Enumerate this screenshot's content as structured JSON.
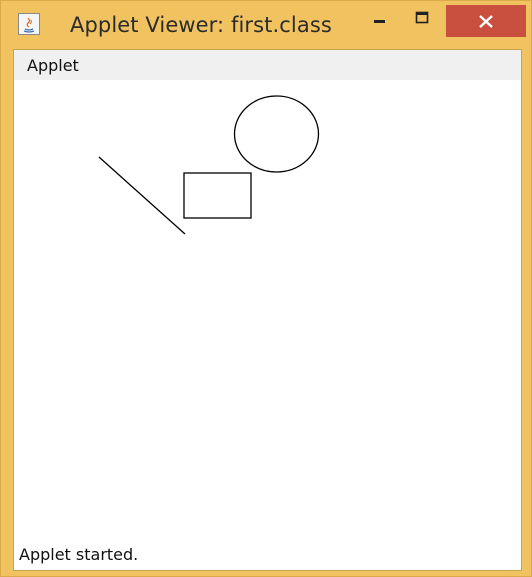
{
  "window": {
    "title": "Applet Viewer: first.class",
    "icon": "java-icon",
    "controls": [
      "minimize-icon",
      "maximize-icon",
      "close-icon"
    ],
    "frame_color": "#f0c260",
    "close_color": "#c94f3f"
  },
  "menubar": {
    "items": [
      {
        "label": "Applet"
      }
    ]
  },
  "status": {
    "text": "Applet started."
  }
}
